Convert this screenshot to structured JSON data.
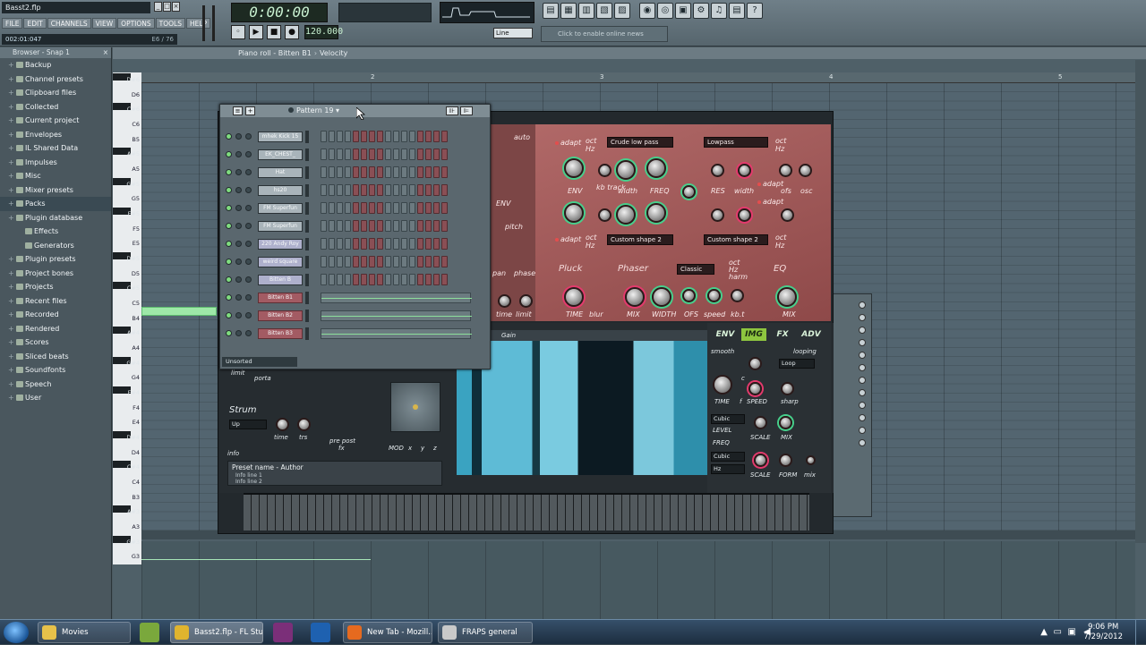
{
  "app": {
    "title": "Basst2.flp",
    "menu": [
      "FILE",
      "EDIT",
      "CHANNELS",
      "VIEW",
      "OPTIONS",
      "TOOLS",
      "HELP"
    ],
    "hint_left": "002:01:047",
    "hint_right": "E6 / 76",
    "time": "0:00:00",
    "bpm": "120.000",
    "snap": "Line",
    "online_news": "Click to enable online news"
  },
  "browser": {
    "title": "Browser - Snap 1",
    "items": [
      {
        "label": "Backup",
        "sub": false
      },
      {
        "label": "Channel presets",
        "sub": false
      },
      {
        "label": "Clipboard files",
        "sub": false
      },
      {
        "label": "Collected",
        "sub": false
      },
      {
        "label": "Current project",
        "sub": false
      },
      {
        "label": "Envelopes",
        "sub": false
      },
      {
        "label": "IL Shared Data",
        "sub": false
      },
      {
        "label": "Impulses",
        "sub": false
      },
      {
        "label": "Misc",
        "sub": false
      },
      {
        "label": "Mixer presets",
        "sub": false
      },
      {
        "label": "Packs",
        "sub": false,
        "highlight": true
      },
      {
        "label": "Plugin database",
        "sub": false
      },
      {
        "label": "Effects",
        "sub": true
      },
      {
        "label": "Generators",
        "sub": true
      },
      {
        "label": "Plugin presets",
        "sub": false
      },
      {
        "label": "Project bones",
        "sub": false
      },
      {
        "label": "Projects",
        "sub": false
      },
      {
        "label": "Recent files",
        "sub": false
      },
      {
        "label": "Recorded",
        "sub": false
      },
      {
        "label": "Rendered",
        "sub": false
      },
      {
        "label": "Scores",
        "sub": false
      },
      {
        "label": "Sliced beats",
        "sub": false
      },
      {
        "label": "Soundfonts",
        "sub": false
      },
      {
        "label": "Speech",
        "sub": false
      },
      {
        "label": "User",
        "sub": false
      }
    ]
  },
  "pianoroll": {
    "title": "Piano roll - Bitten B1",
    "target": "Velocity",
    "ruler": [
      "2",
      "3",
      "4",
      "5"
    ],
    "keys": [
      "D#6",
      "D6",
      "C#6",
      "C6",
      "B5",
      "A#5",
      "A5",
      "G#5",
      "G5",
      "F#5",
      "F5",
      "E5",
      "D#5",
      "D5",
      "C#5",
      "C5",
      "B4",
      "A#4",
      "A4",
      "G#4",
      "G4",
      "F#4",
      "F4",
      "E4",
      "D#4",
      "D4",
      "C#4",
      "C4",
      "B3",
      "A#3",
      "A3",
      "G#3",
      "G3"
    ]
  },
  "rack": {
    "pattern": "Pattern 19",
    "footer": "Unsorted",
    "channels": [
      {
        "name": "mhek Kick 15",
        "type": "steps",
        "color": "grey"
      },
      {
        "name": "EK_CHEST_",
        "type": "steps",
        "color": "grey"
      },
      {
        "name": "Hat",
        "type": "steps",
        "color": "grey"
      },
      {
        "name": "hs20",
        "type": "steps",
        "color": "grey"
      },
      {
        "name": "FM Superfun",
        "type": "steps",
        "color": "grey"
      },
      {
        "name": "FM Superfun",
        "type": "steps",
        "color": "grey"
      },
      {
        "name": "220 Andy Roy",
        "type": "steps",
        "color": "lav"
      },
      {
        "name": "weird square",
        "type": "steps",
        "color": "lav"
      },
      {
        "name": "Bitten B",
        "type": "steps",
        "color": "lav"
      },
      {
        "name": "Bitten B1",
        "type": "piano",
        "color": "red"
      },
      {
        "name": "Bitten B2",
        "type": "piano",
        "color": "red"
      },
      {
        "name": "Bitten B3",
        "type": "piano",
        "color": "red"
      }
    ]
  },
  "synth": {
    "filter1": "Crude low pass",
    "filter2": "Lowpass",
    "shape1": "Custom shape 2",
    "shape2": "Custom shape 2",
    "phaser_mode": "Classic",
    "labels": {
      "auto": "auto",
      "adapt": "adapt",
      "oct": "oct",
      "hz": "Hz",
      "env": "ENV",
      "kb_track": "kb track",
      "width": "width",
      "freq": "FREQ",
      "res": "RES",
      "ofs": "ofs",
      "osc": "osc",
      "pitch": "pitch",
      "pan": "pan",
      "phase": "phase",
      "time_low": "time",
      "limit_low": "limit",
      "pluck": "Pluck",
      "phaser": "Phaser",
      "harm": "harm",
      "eq": "EQ",
      "time": "TIME",
      "blur": "blur",
      "mix": "MIX",
      "width_up": "WIDTH",
      "ofs_up": "OFS",
      "speed": "speed",
      "kbt": "kb.t",
      "gain": "Gain",
      "limit": "limit",
      "porta": "porta",
      "strum": "Strum",
      "strum_mode": "Up",
      "time2": "time",
      "trs": "trs",
      "pre_post": "pre post",
      "fx": "fx",
      "mod": "MOD",
      "x": "x",
      "y": "y",
      "z": "z",
      "info": "info"
    },
    "preset_name": "Preset name - Author",
    "info1": "Info line 1",
    "info2": "Info line 2",
    "tabs": [
      "ENV",
      "IMG",
      "FX",
      "ADV"
    ],
    "active_tab": "IMG",
    "right": {
      "smooth": "smooth",
      "looping": "looping",
      "loop_mode": "Loop",
      "c": "c",
      "time": "TIME",
      "speed": "SPEED",
      "f": "f",
      "sharp": "sharp",
      "cubic1": "Cubic",
      "level": "LEVEL",
      "scale1": "SCALE",
      "mix": "MIX",
      "freq": "FREQ",
      "cubic2": "Cubic",
      "hz": "Hz",
      "scale2": "SCALE",
      "form": "FORM",
      "mix2": "mix"
    }
  },
  "taskbar": {
    "tasks": [
      {
        "label": "Movies",
        "color": "#e7c14a"
      },
      {
        "label": "Basst2.flp - FL Stu...",
        "color": "#e0b42e",
        "active": true
      },
      {
        "label": "New Tab - Mozill...",
        "color": "#e66a1f"
      },
      {
        "label": "FRAPS general",
        "color": "#c9c9c9"
      }
    ],
    "time": "9:06 PM",
    "date": "7/29/2012"
  }
}
